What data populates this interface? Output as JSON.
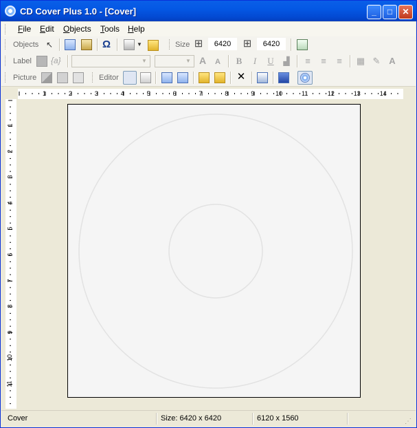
{
  "window": {
    "title": "CD Cover Plus 1.0 - [Cover]",
    "controls": {
      "minimize": "_",
      "maximize": "□",
      "close": "✕"
    }
  },
  "menu": {
    "items": [
      {
        "label": "File",
        "accel": "F",
        "rest": "ile"
      },
      {
        "label": "Edit",
        "accel": "E",
        "rest": "dit"
      },
      {
        "label": "Objects",
        "accel": "O",
        "rest": "bjects"
      },
      {
        "label": "Tools",
        "accel": "T",
        "rest": "ools"
      },
      {
        "label": "Help",
        "accel": "H",
        "rest": "elp"
      }
    ]
  },
  "toolbars": {
    "objects": {
      "label": "Objects",
      "omega": "Ω"
    },
    "size": {
      "label": "Size",
      "width_value": "6420",
      "height_value": "6420"
    },
    "label": {
      "label": "Label",
      "field_symbol": "{a}",
      "font_name": "",
      "font_size": "",
      "bold": "B",
      "italic": "I",
      "underline": "U",
      "font_a": "A",
      "font_grow": "A",
      "font_shrink": "A"
    },
    "picture": {
      "label": "Picture"
    },
    "editor": {
      "label": "Editor",
      "delete": "✕"
    }
  },
  "ruler": {
    "h_numbers": [
      "1",
      "2",
      "3",
      "4",
      "5",
      "6",
      "7",
      "8",
      "9",
      "10",
      "11",
      "12",
      "13",
      "14"
    ],
    "v_numbers": [
      "1",
      "2",
      "3",
      "4",
      "5",
      "6",
      "7",
      "8",
      "9",
      "10",
      "11"
    ]
  },
  "statusbar": {
    "mode": "Cover",
    "size": "Size: 6420 x 6420",
    "coords": "6120 x 1560"
  },
  "colors": {
    "titlebar": "#0458e4",
    "workspace": "#ece9d8",
    "cover": "#f5f5f5"
  }
}
